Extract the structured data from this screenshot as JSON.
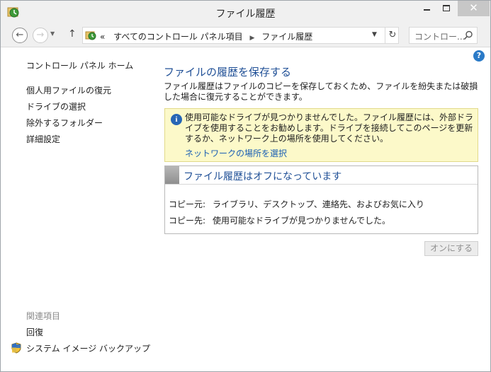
{
  "window": {
    "title": "ファイル履歴",
    "controls": {
      "minimize": "—",
      "maximize": "□",
      "close": "✕"
    }
  },
  "address": {
    "crumb_prefix": "«",
    "crumbs": [
      "すべてのコントロール パネル項目",
      "ファイル履歴"
    ],
    "search_placeholder": "コントロー..."
  },
  "sidebar": {
    "home": "コントロール パネル ホーム",
    "links": [
      "個人用ファイルの復元",
      "ドライブの選択",
      "除外するフォルダー",
      "詳細設定"
    ],
    "related_heading": "関連項目",
    "related_links": [
      "回復",
      "システム イメージ バックアップ"
    ]
  },
  "main": {
    "title": "ファイルの履歴を保存する",
    "description": "ファイル履歴はファイルのコピーを保存しておくため、ファイルを紛失または破損した場合に復元することができます。",
    "info": {
      "message": "使用可能なドライブが見つかりませんでした。ファイル履歴には、外部ドライブを使用することをお勧めします。ドライブを接続してこのページを更新するか、ネットワーク上の場所を使用してください。",
      "link": "ネットワークの場所を選択"
    },
    "status": {
      "title": "ファイル履歴はオフになっています",
      "rows": [
        {
          "label": "コピー元:",
          "value": "ライブラリ、デスクトップ、連絡先、およびお気に入り"
        },
        {
          "label": "コピー先:",
          "value": "使用可能なドライブが見つかりませんでした。"
        }
      ]
    },
    "turn_on_button": "オンにする"
  },
  "colors": {
    "title_blue": "#1f4f96",
    "link_blue": "#1a5fb4",
    "info_bg": "#fcf9c9"
  }
}
